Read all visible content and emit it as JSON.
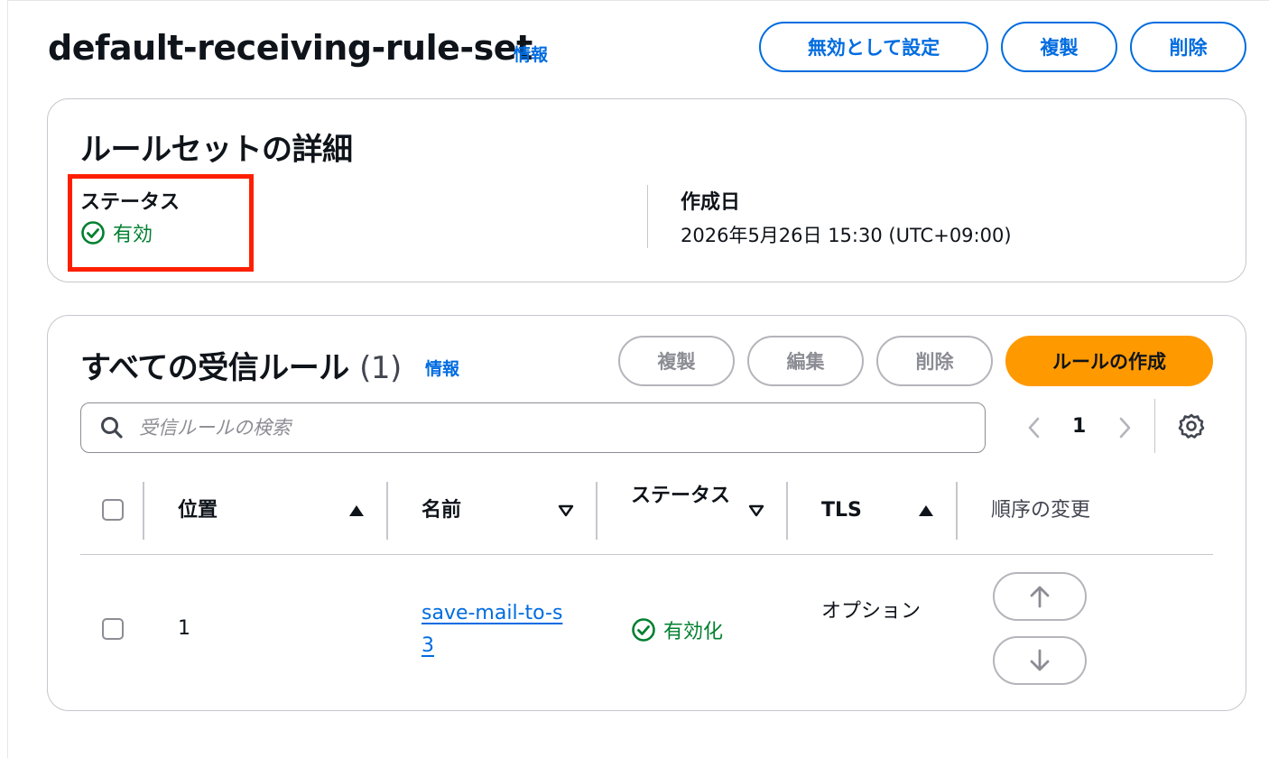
{
  "header": {
    "title": "default-receiving-rule-set",
    "info": "情報",
    "buttons": {
      "disable": "無効として設定",
      "duplicate": "複製",
      "delete": "削除"
    }
  },
  "details": {
    "title": "ルールセットの詳細",
    "status_label": "ステータス",
    "status_value": "有効",
    "created_label": "作成日",
    "created_value": "2026年5月26日 15:30 (UTC+09:00)"
  },
  "rules": {
    "title": "すべての受信ルール",
    "count": "(1)",
    "info": "情報",
    "buttons": {
      "duplicate": "複製",
      "edit": "編集",
      "delete": "削除",
      "create": "ルールの作成"
    },
    "search_placeholder": "受信ルールの検索",
    "page": "1",
    "columns": {
      "position": "位置",
      "name": "名前",
      "status": "ステータス",
      "tls": "TLS",
      "order": "順序の変更"
    },
    "rows": [
      {
        "position": "1",
        "name": "save-mail-to-s3",
        "status": "有効化",
        "tls": "オプション"
      }
    ]
  },
  "colors": {
    "link": "#006ce0",
    "success": "#00802f",
    "primary": "#ff9900",
    "highlight": "#ff1f00"
  }
}
